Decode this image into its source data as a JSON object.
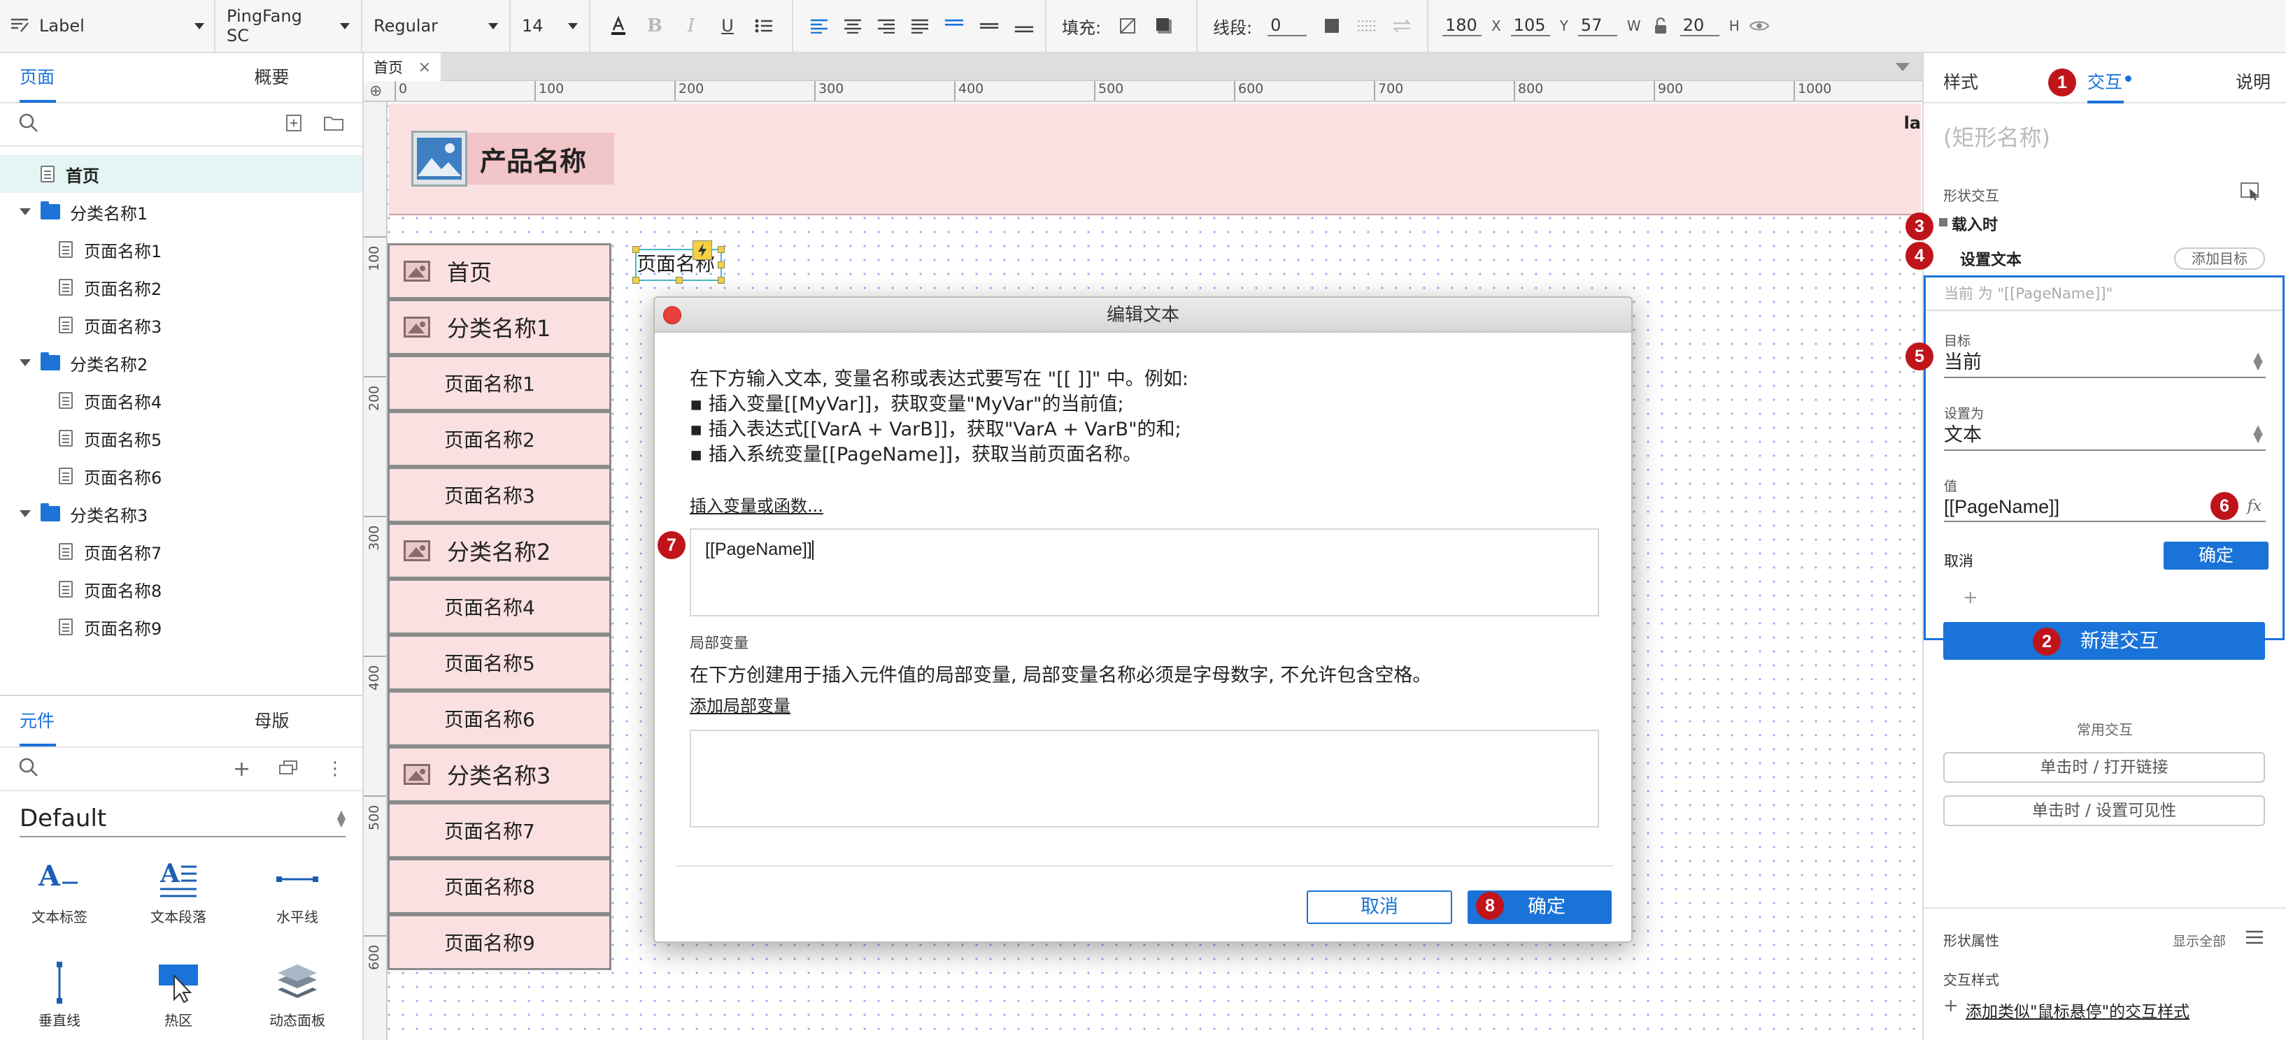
{
  "toolbar": {
    "style_name": "Label",
    "font_family": "PingFang SC",
    "font_weight": "Regular",
    "font_size": "14",
    "fill_label": "填充:",
    "stroke_label": "线段:",
    "stroke_value": "0",
    "x": "180",
    "x_unit": "X",
    "y": "105",
    "y_unit": "Y",
    "w": "57",
    "w_unit": "W",
    "h": "20",
    "h_unit": "H"
  },
  "left_panel": {
    "tabs": [
      "页面",
      "概要"
    ],
    "tree": [
      {
        "label": "首页",
        "type": "page",
        "level": 0,
        "selected": true
      },
      {
        "label": "分类名称1",
        "type": "folder",
        "level": 0
      },
      {
        "label": "页面名称1",
        "type": "page",
        "level": 1
      },
      {
        "label": "页面名称2",
        "type": "page",
        "level": 1
      },
      {
        "label": "页面名称3",
        "type": "page",
        "level": 1
      },
      {
        "label": "分类名称2",
        "type": "folder",
        "level": 0
      },
      {
        "label": "页面名称4",
        "type": "page",
        "level": 1
      },
      {
        "label": "页面名称5",
        "type": "page",
        "level": 1
      },
      {
        "label": "页面名称6",
        "type": "page",
        "level": 1
      },
      {
        "label": "分类名称3",
        "type": "folder",
        "level": 0
      },
      {
        "label": "页面名称7",
        "type": "page",
        "level": 1
      },
      {
        "label": "页面名称8",
        "type": "page",
        "level": 1
      },
      {
        "label": "页面名称9",
        "type": "page",
        "level": 1
      }
    ],
    "bottom_tabs": [
      "元件",
      "母版"
    ],
    "library": "Default",
    "components": [
      "文本标签",
      "文本段落",
      "水平线",
      "垂直线",
      "热区",
      "动态面板"
    ]
  },
  "canvas": {
    "tab_name": "首页",
    "ruler_top": [
      "0",
      "100",
      "200",
      "300",
      "400",
      "500",
      "600",
      "700",
      "800",
      "900",
      "1000"
    ],
    "ruler_left": [
      "100",
      "200",
      "300",
      "400",
      "500",
      "600"
    ],
    "header_title": "产品名称",
    "header_edge_text": "la",
    "selected_label": "页面名称",
    "nav_items": [
      {
        "label": "首页",
        "icon": true
      },
      {
        "label": "分类名称1",
        "icon": true
      },
      {
        "label": "页面名称1",
        "icon": false
      },
      {
        "label": "页面名称2",
        "icon": false
      },
      {
        "label": "页面名称3",
        "icon": false
      },
      {
        "label": "分类名称2",
        "icon": true
      },
      {
        "label": "页面名称4",
        "icon": false
      },
      {
        "label": "页面名称5",
        "icon": false
      },
      {
        "label": "页面名称6",
        "icon": false
      },
      {
        "label": "分类名称3",
        "icon": true
      },
      {
        "label": "页面名称7",
        "icon": false
      },
      {
        "label": "页面名称8",
        "icon": false
      },
      {
        "label": "页面名称9",
        "icon": false
      }
    ]
  },
  "dialog": {
    "title": "编辑文本",
    "intro": "在下方输入文本, 变量名称或表达式要写在 \"[[ ]]\" 中。例如:",
    "bullets": [
      "▪ 插入变量[[MyVar]]，获取变量\"MyVar\"的当前值;",
      "▪ 插入表达式[[VarA + VarB]]，获取\"VarA + VarB\"的和;",
      "▪ 插入系统变量[[PageName]]，获取当前页面名称。"
    ],
    "insert_link": "插入变量或函数...",
    "text_value": "[[PageName]]",
    "local_var_title": "局部变量",
    "local_var_desc": "在下方创建用于插入元件值的局部变量, 局部变量名称必须是字母数字, 不允许包含空格。",
    "add_local_var": "添加局部变量",
    "cancel": "取消",
    "ok": "确定"
  },
  "right_panel": {
    "tabs": [
      "样式",
      "交互",
      "说明"
    ],
    "shape_name_placeholder": "(矩形名称)",
    "shape_interaction": "形状交互",
    "event": "载入时",
    "action": "设置文本",
    "add_target": "添加目标",
    "summary": "当前 为 \"[[PageName]]\"",
    "target_label": "目标",
    "target_value": "当前",
    "set_to_label": "设置为",
    "set_to_value": "文本",
    "value_label": "值",
    "value_value": "[[PageName]]",
    "fx": "fx",
    "cancel": "取消",
    "ok": "确定",
    "plus": "+",
    "new_interaction": "新建交互",
    "common_title": "常用交互",
    "common": [
      "单击时 / 打开链接",
      "单击时 / 设置可见性"
    ],
    "shape_props": "形状属性",
    "show_all": "显示全部",
    "interaction_style": "交互样式",
    "add_hover_style": "添加类似\"鼠标悬停\"的交互样式"
  },
  "badges": [
    "1",
    "2",
    "3",
    "4",
    "5",
    "6",
    "7",
    "8"
  ]
}
